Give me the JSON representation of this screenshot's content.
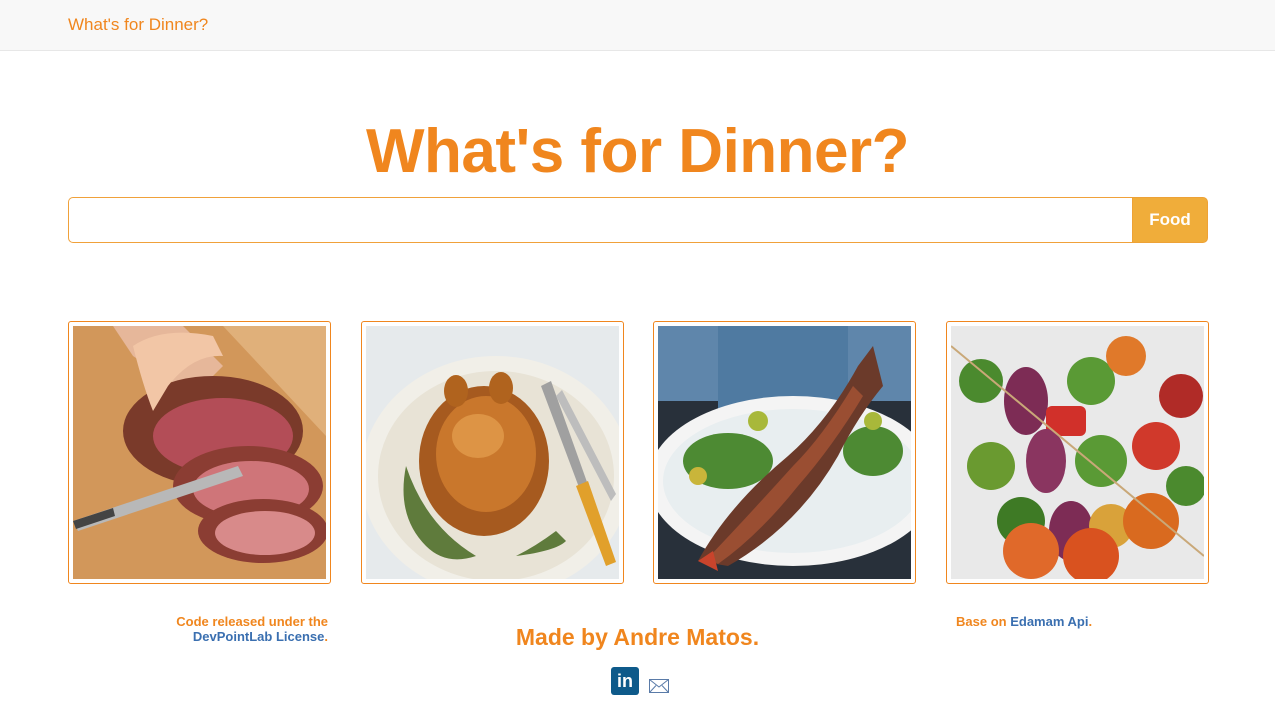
{
  "navbar": {
    "brand": "What's for Dinner?"
  },
  "hero": {
    "title": "What's for Dinner?"
  },
  "search": {
    "value": "",
    "placeholder": "",
    "button_label": "Food"
  },
  "thumbnails": [
    {
      "name": "roast-beef-image"
    },
    {
      "name": "roast-chicken-image"
    },
    {
      "name": "grilled-fish-image"
    },
    {
      "name": "vegetable-skewers-image"
    }
  ],
  "footer": {
    "license_prefix": "Code released under the",
    "license_link": "DevPointLab License",
    "license_suffix": ".",
    "credit": "Made by Andre Matos.",
    "api_prefix": "Base on",
    "api_link": "Edamam Api",
    "api_suffix": "."
  },
  "social": {
    "linkedin_icon_text": "in",
    "linkedin_icon": "linkedin-icon",
    "mail_icon": "envelope-icon"
  },
  "colors": {
    "accent": "#f0861e",
    "button": "#f0ad3a",
    "link": "#3a6fb0",
    "navbar_bg": "#f8f8f8"
  }
}
